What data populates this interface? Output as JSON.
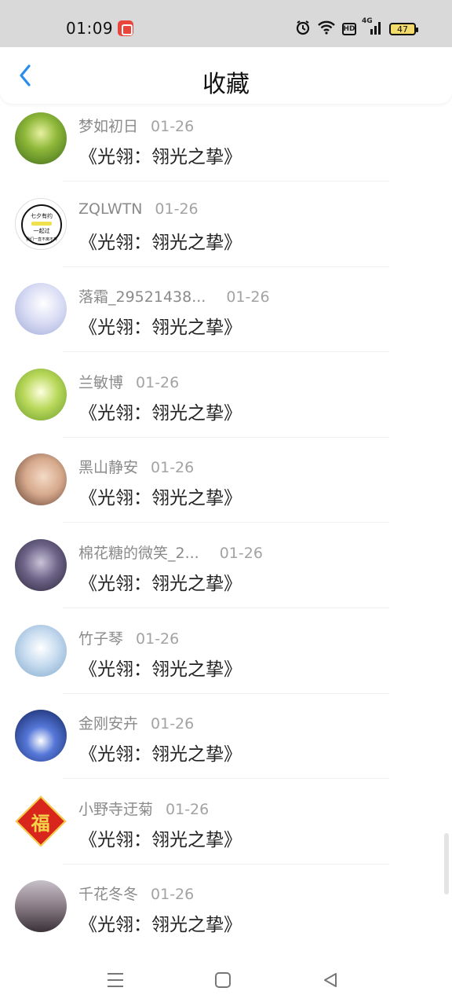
{
  "status_bar": {
    "time": "01:09",
    "app_icon": "notification-app-icon",
    "hd_label": "HD",
    "network_label": "4G",
    "battery_level": "47",
    "icons": [
      "alarm-icon",
      "wifi-icon",
      "hd-icon",
      "signal-icon",
      "battery-icon"
    ]
  },
  "header": {
    "title": "收藏",
    "back_icon": "chevron-left-icon",
    "accent_color": "#2a8cf0"
  },
  "favorites": [
    {
      "name": "梦如初日",
      "date": "01-26",
      "title": "《光翎：翎光之挚》",
      "avatar": "forest-avatar"
    },
    {
      "name": "ZQLWTN",
      "date": "01-26",
      "title": "《光翎：翎光之挚》",
      "avatar": "badge-avatar",
      "avatar_text": [
        "七夕有约",
        "一起过",
        "我们一直不离不弃"
      ]
    },
    {
      "name": "落霜_29521438...",
      "date": "01-26",
      "title": "《光翎：翎光之挚》",
      "avatar": "anime-avatar"
    },
    {
      "name": "兰敏博",
      "date": "01-26",
      "title": "《光翎：翎光之挚》",
      "avatar": "sprout-avatar"
    },
    {
      "name": "黑山静安",
      "date": "01-26",
      "title": "《光翎：翎光之挚》",
      "avatar": "girl-avatar"
    },
    {
      "name": "棉花糖的微笑_2...",
      "date": "01-26",
      "title": "《光翎：翎光之挚》",
      "avatar": "dark-anime-avatar"
    },
    {
      "name": "竹子琴",
      "date": "01-26",
      "title": "《光翎：翎光之挚》",
      "avatar": "blue-anime-avatar"
    },
    {
      "name": "金刚安卉",
      "date": "01-26",
      "title": "《光翎：翎光之挚》",
      "avatar": "astronaut-avatar"
    },
    {
      "name": "小野寺迂菊",
      "date": "01-26",
      "title": "《光翎：翎光之挚》",
      "avatar": "fu-avatar",
      "avatar_text": "福"
    },
    {
      "name": "千花冬冬",
      "date": "01-26",
      "title": "《光翎：翎光之挚》",
      "avatar": "night-avatar"
    }
  ],
  "nav_bar": {
    "icons": [
      "menu-icon",
      "home-icon",
      "back-triangle-icon"
    ]
  }
}
